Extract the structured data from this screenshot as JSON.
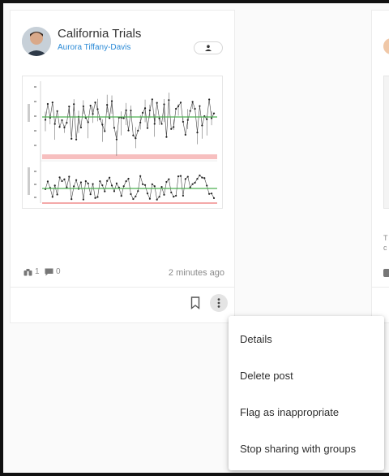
{
  "card": {
    "title": "California Trials",
    "author": "Aurora Tiffany-Davis",
    "views_count": "1",
    "comments_count": "0",
    "timestamp": "2 minutes ago"
  },
  "menu": {
    "items": [
      {
        "label": "Details"
      },
      {
        "label": "Delete post"
      },
      {
        "label": "Flag as inappropriate"
      },
      {
        "label": "Stop sharing with groups"
      }
    ]
  },
  "card2": {
    "text_line1": "T",
    "text_line2": "c"
  },
  "colors": {
    "accent_link": "#2b8ad6",
    "center_line": "#4caf50",
    "limit_band": "#f4a9a9",
    "menu_shadow": "rgba(0,0,0,0.22)"
  },
  "icons": {
    "share": "group-share-icon",
    "views": "binoculars-icon",
    "comments": "comment-icon",
    "bookmark": "bookmark-icon",
    "more": "more-vert-icon"
  }
}
